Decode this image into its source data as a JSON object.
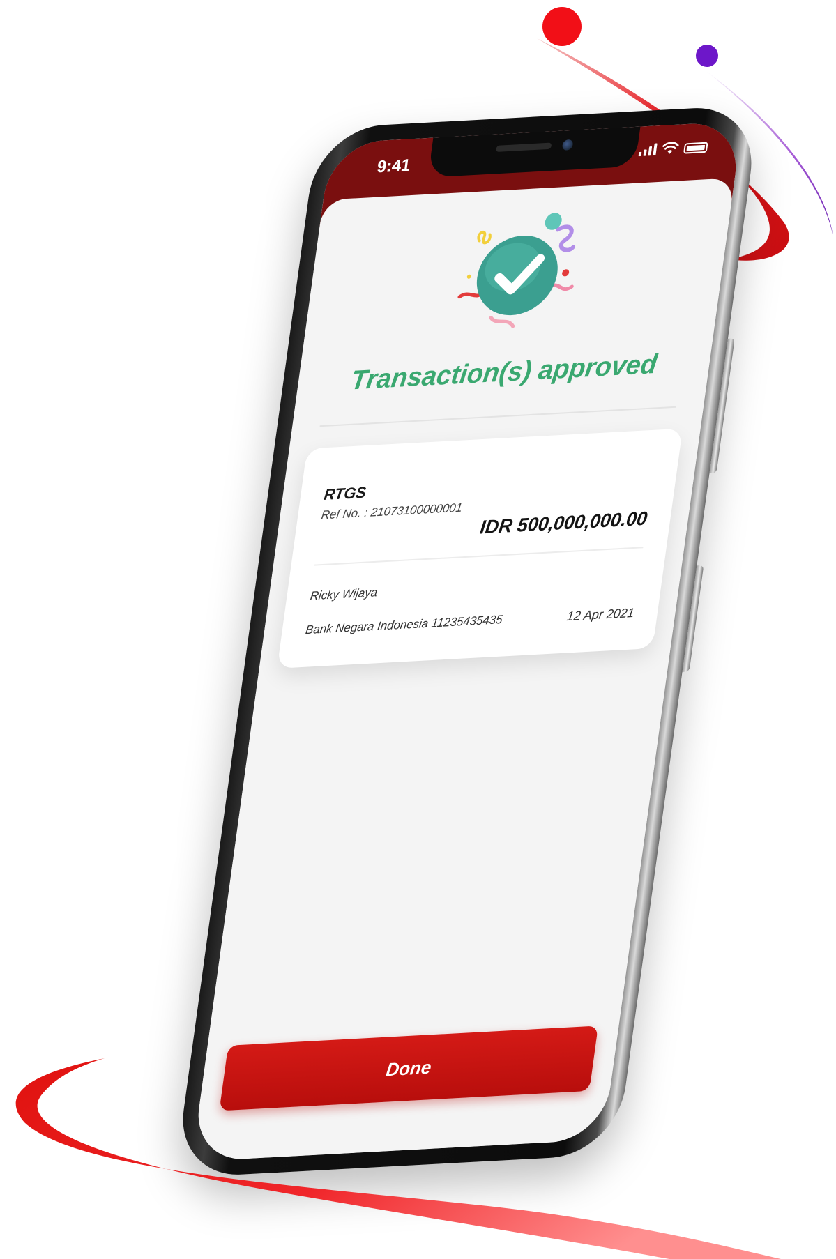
{
  "status_bar": {
    "time": "9:41",
    "signal_icon": "signal-icon",
    "wifi_icon": "wifi-icon",
    "battery_icon": "battery-icon"
  },
  "result": {
    "illustration_icon": "success-check-icon",
    "title": "Transaction(s) approved"
  },
  "transaction": {
    "type": "RTGS",
    "ref_no": "Ref No. : 21073100000001",
    "amount": "IDR 500,000,000.00",
    "beneficiary_name": "Ricky Wijaya",
    "beneficiary_bank": "Bank Negara Indonesia 11235435435",
    "date": "12 Apr 2021"
  },
  "actions": {
    "done_label": "Done"
  },
  "colors": {
    "header_bg": "#7a0f0f",
    "success_green": "#3aa870",
    "primary_red": "#c8120f",
    "accent_purple": "#7a1fc8"
  }
}
